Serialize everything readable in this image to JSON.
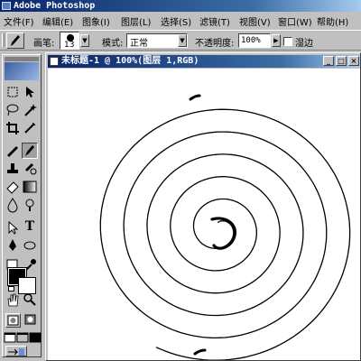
{
  "app": {
    "title": "Adobe Photoshop"
  },
  "menu": [
    {
      "label": "文件(F)"
    },
    {
      "label": "编辑(E)"
    },
    {
      "label": "图象(I)"
    },
    {
      "label": "图层(L)"
    },
    {
      "label": "选择(S)"
    },
    {
      "label": "滤镜(T)"
    },
    {
      "label": "视图(V)"
    },
    {
      "label": "窗口(W)"
    },
    {
      "label": "帮助(H)"
    }
  ],
  "options": {
    "brush_label": "画笔:",
    "brush_size": "13",
    "mode_label": "模式:",
    "mode_value": "正常",
    "opacity_label": "不透明度:",
    "opacity_value": "100%",
    "wet_edges_label": "湿边"
  },
  "document": {
    "title": "未标题-1 @ 100%(图层 1,RGB)"
  },
  "colors": {
    "foreground": "#000000",
    "background": "#ffffff",
    "title_active": "#0a246a"
  },
  "tools": [
    "marquee-icon",
    "move-icon",
    "lasso-icon",
    "magic-wand-icon",
    "crop-icon",
    "slice-icon",
    "healing-icon",
    "brush-icon",
    "clone-stamp-icon",
    "history-brush-icon",
    "eraser-icon",
    "gradient-icon",
    "blur-icon",
    "dodge-icon",
    "path-select-icon",
    "type-icon",
    "pen-icon",
    "shape-icon",
    "notes-icon",
    "eyedropper-icon",
    "hand-icon",
    "zoom-icon"
  ]
}
